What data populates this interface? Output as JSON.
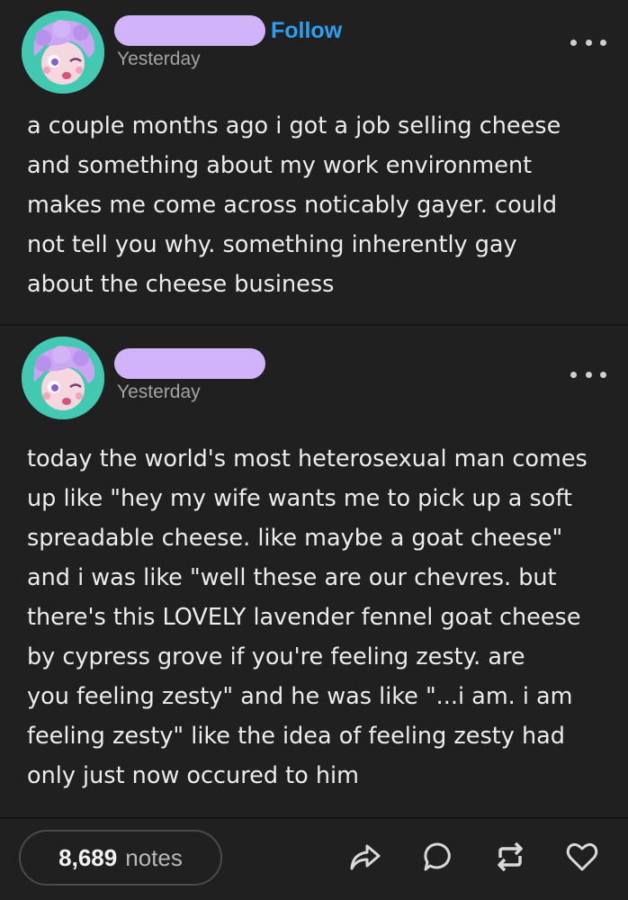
{
  "post1": {
    "follow_label": "Follow",
    "timestamp": "Yesterday",
    "lines": [
      "a couple months ago i got a job selling cheese",
      "and something about my work environment",
      "makes me come across noticably gayer. could",
      "not tell you why. something inherently gay",
      "about the cheese business"
    ]
  },
  "post2": {
    "timestamp": "Yesterday",
    "lines": [
      "today the world's most heterosexual man comes",
      "up like \"hey my wife wants me to pick up a soft",
      "spreadable cheese. like maybe a goat cheese\"",
      "and i was like \"well these are our chevres. but",
      "there's this LOVELY lavender fennel goat cheese",
      "by cypress grove if you're feeling zesty. are",
      "you feeling zesty\" and he was like \"...i am. i am",
      "feeling zesty\" like the idea of feeling zesty had",
      "only just now occured to him"
    ]
  },
  "footer": {
    "notes_count": "8,689",
    "notes_label": "notes"
  },
  "icons": {
    "share": "share-arrow-icon",
    "reply": "speech-bubble-icon",
    "reblog": "reblog-icon",
    "like": "heart-icon"
  },
  "colors": {
    "background": "#202020",
    "follow": "#2c9ff2",
    "redaction": "#d1b3fb",
    "avatar_bg": "#43c8b1"
  }
}
